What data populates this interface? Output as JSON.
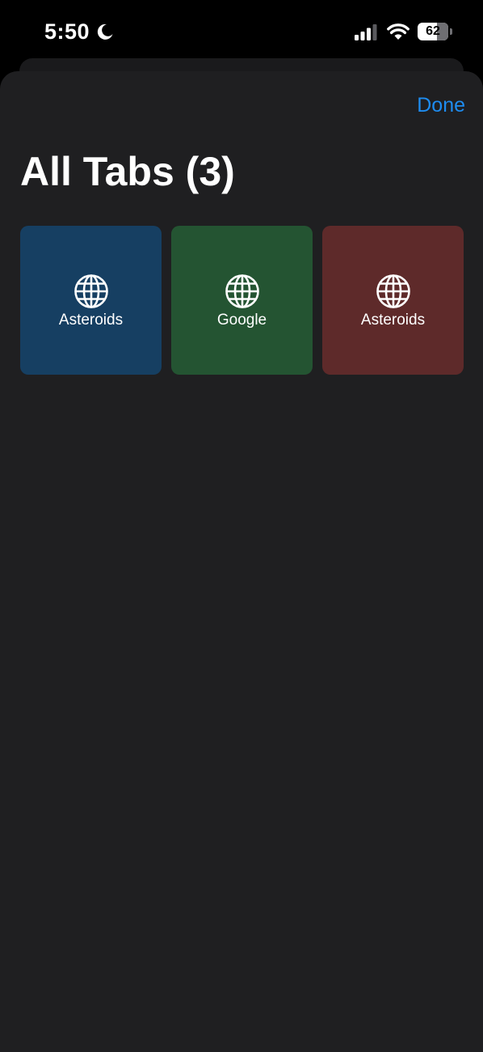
{
  "status_bar": {
    "time": "5:50",
    "battery_level": "62",
    "battery_fraction": 0.62,
    "icons": [
      "moon-icon",
      "signal-icon",
      "wifi-icon",
      "battery-icon"
    ]
  },
  "header": {
    "done_label": "Done",
    "title": "All Tabs (3)"
  },
  "tabs": [
    {
      "label": "Asteroids",
      "color": "#163f62",
      "icon": "globe-icon"
    },
    {
      "label": "Google",
      "color": "#245432",
      "icon": "globe-icon"
    },
    {
      "label": "Asteroids",
      "color": "#5e2a2a",
      "icon": "globe-icon"
    }
  ],
  "colors": {
    "background": "#000000",
    "sheet": "#1f1f21",
    "accent": "#1e8cf0",
    "text": "#ffffff"
  }
}
